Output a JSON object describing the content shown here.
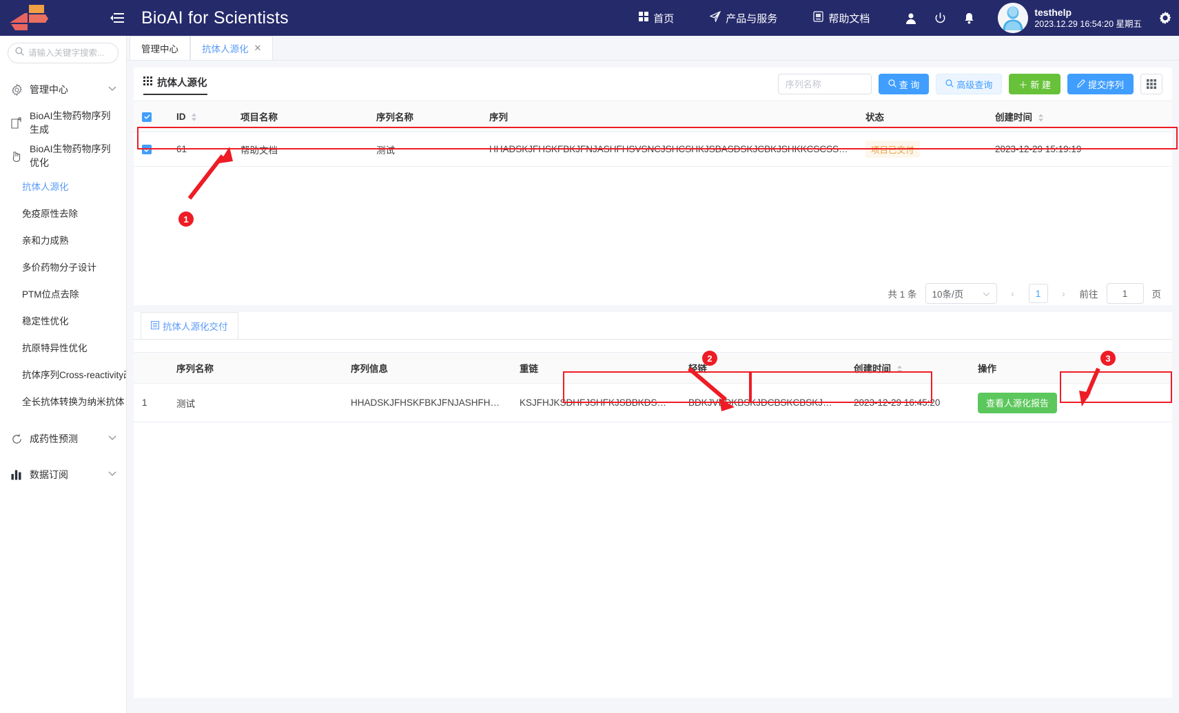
{
  "header": {
    "app_title": "BioAI for Scientists",
    "menu_icon": "hamburger-icon",
    "nav": [
      {
        "label": "首页",
        "icon": "grid-icon"
      },
      {
        "label": "产品与服务",
        "icon": "send-icon"
      },
      {
        "label": "帮助文档",
        "icon": "doc-icon"
      }
    ],
    "icons": [
      {
        "name": "user-icon"
      },
      {
        "name": "power-icon"
      },
      {
        "name": "bell-icon"
      }
    ],
    "user": {
      "name": "testhelp",
      "datetime": "2023.12.29 16:54:20 星期五"
    },
    "settings_icon": "gear-icon"
  },
  "sidebar": {
    "search_placeholder": "请输入关键字搜索...",
    "groups": [
      {
        "label": "管理中心",
        "icon": "gear-icon",
        "expandable": true
      },
      {
        "label": "BioAI生物药物序列生成",
        "icon": "clipboard-icon",
        "expandable": false
      },
      {
        "label": "BioAI生物药物序列优化",
        "icon": "hand-icon",
        "expandable": false
      }
    ],
    "sub_items": [
      {
        "label": "抗体人源化",
        "active": true
      },
      {
        "label": "免疫原性去除",
        "active": false
      },
      {
        "label": "亲和力成熟",
        "active": false
      },
      {
        "label": "多价药物分子设计",
        "active": false
      },
      {
        "label": "PTM位点去除",
        "active": false
      },
      {
        "label": "稳定性优化",
        "active": false
      },
      {
        "label": "抗原特异性优化",
        "active": false
      },
      {
        "label": "抗体序列Cross-reactivity改",
        "active": false
      },
      {
        "label": "全长抗体转换为纳米抗体",
        "active": false
      }
    ],
    "bottom_groups": [
      {
        "label": "成药性预测",
        "icon": "refresh-icon",
        "expandable": true
      },
      {
        "label": "数据订阅",
        "icon": "bar-chart-icon",
        "expandable": true
      }
    ]
  },
  "tabs": [
    {
      "label": "管理中心",
      "active": false,
      "closable": false
    },
    {
      "label": "抗体人源化",
      "active": true,
      "closable": true
    }
  ],
  "panel": {
    "title": "抗体人源化",
    "title_icon": "grid-icon",
    "search_placeholder": "序列名称",
    "buttons": {
      "query": "查 询",
      "advanced_query": "高级查询",
      "create": "新 建",
      "submit_sequence": "提交序列",
      "columns_icon": "table-columns-icon"
    }
  },
  "main_table": {
    "columns": [
      "",
      "ID",
      "项目名称",
      "序列名称",
      "序列",
      "状态",
      "创建时间"
    ],
    "rows": [
      {
        "checked": true,
        "id": "61",
        "project": "帮助文档",
        "sequence_name": "测试",
        "sequence": "HHADSKJFHSKFBKJFNJASHFHSVSNCJSHCSHKJSBASDSKJCBKJSHKKCSCSSFCSC…",
        "status": "项目已交付",
        "created": "2023-12-29 15:19:19"
      }
    ]
  },
  "pagination": {
    "total_text": "共 1 条",
    "page_size": "10条/页",
    "prev": "‹",
    "current_page": "1",
    "next": "›",
    "jump_label": "前往",
    "jump_value": "1",
    "page_unit": "页"
  },
  "detail": {
    "tab_label": "抗体人源化交付",
    "tab_icon": "list-icon",
    "columns": [
      "",
      "序列名称",
      "序列信息",
      "重链",
      "轻链",
      "创建时间",
      "操作"
    ],
    "rows": [
      {
        "index": "1",
        "sequence_name": "测试",
        "sequence_info": "HHADSKJFHSKFBKJFNJASHFHSV…",
        "heavy_chain": "KSJFHJKSDHFJSHFKJSBBKDSBC…",
        "light_chain": "BDKJVBDKBSKJDCBSKCBSKJCBS…",
        "created": "2023-12-29 16:45:20",
        "action": "查看人源化报告"
      }
    ]
  },
  "annotations": [
    {
      "number": "1"
    },
    {
      "number": "2"
    },
    {
      "number": "3"
    }
  ],
  "colors": {
    "topbar": "#252a6b",
    "accent_blue": "#409eff",
    "green": "#67c23a",
    "annotation_red": "#ee1c25",
    "status_orange": "#e6a23c"
  }
}
